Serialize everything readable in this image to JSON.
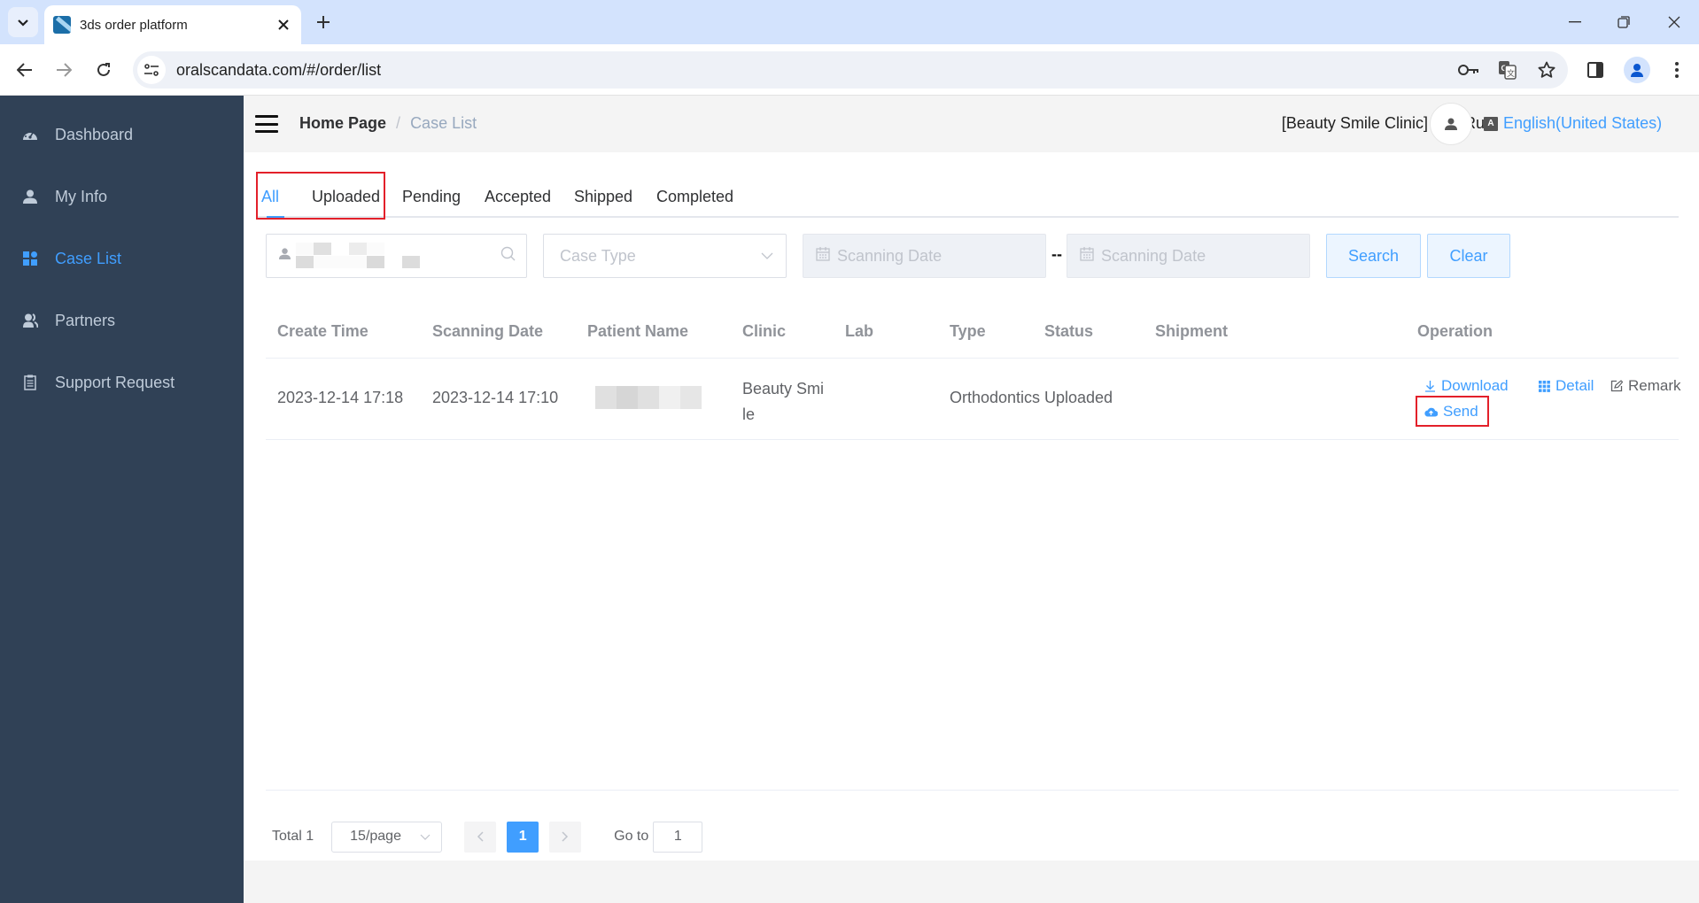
{
  "browser": {
    "tab_title": "3ds order platform",
    "url": "oralscandata.com/#/order/list",
    "icons": {
      "tab_search": "chevron-down-icon",
      "new_tab": "plus-icon",
      "back": "arrow-left-icon",
      "forward": "arrow-right-icon",
      "reload": "reload-icon",
      "password": "key-icon",
      "translate": "translate-icon",
      "bookmark": "star-icon",
      "side_panel": "side-panel-icon",
      "profile": "profile-icon",
      "menu": "kebab-menu-icon"
    },
    "glyphs": {
      "chevron": "⌄",
      "plus": "+",
      "close": "✕",
      "minimize": "—",
      "restore": "❐",
      "win_close": "✕",
      "back": "←",
      "forward": "→",
      "reload": "↻",
      "site_info": "⚙",
      "key": "⚿",
      "translate": "G文",
      "star": "☆",
      "side_panel": "▮",
      "menu": "⋮"
    }
  },
  "sidebar": {
    "items": [
      {
        "label": "Dashboard",
        "icon": "dashboard-gauge-icon",
        "active": false
      },
      {
        "label": "My Info",
        "icon": "user-icon",
        "active": false
      },
      {
        "label": "Case List",
        "icon": "grid-icon",
        "active": true
      },
      {
        "label": "Partners",
        "icon": "users-icon",
        "active": false
      },
      {
        "label": "Support Request",
        "icon": "clipboard-icon",
        "active": false
      }
    ]
  },
  "header": {
    "breadcrumb": {
      "home": "Home Page",
      "separator": "/",
      "current": "Case List"
    },
    "user_name": "[Beauty Smile Clinic] XiaoRu",
    "language": "English(United States)",
    "language_icon_text": "A"
  },
  "tabs": {
    "items": [
      {
        "label": "All",
        "active": true
      },
      {
        "label": "Uploaded",
        "active": false
      },
      {
        "label": "Pending",
        "active": false
      },
      {
        "label": "Accepted",
        "active": false
      },
      {
        "label": "Shipped",
        "active": false
      },
      {
        "label": "Completed",
        "active": false
      }
    ]
  },
  "filters": {
    "patient_search": {
      "value": "[redacted]",
      "icon": "search-icon"
    },
    "case_type": {
      "placeholder": "Case Type"
    },
    "date_start": {
      "placeholder": "Scanning Date"
    },
    "date_separator": "--",
    "date_end": {
      "placeholder": "Scanning Date"
    },
    "search_label": "Search",
    "clear_label": "Clear"
  },
  "table": {
    "columns": [
      "Create Time",
      "Scanning Date",
      "Patient Name",
      "Clinic",
      "Lab",
      "Type",
      "Status",
      "Shipment",
      "Operation"
    ],
    "rows": [
      {
        "create_time": "2023-12-14 17:18",
        "scanning_date": "2023-12-14 17:10",
        "patient_name": "[redacted]",
        "clinic_line1": "Beauty Smi",
        "clinic_line2": "le",
        "lab": "",
        "type": "Orthodontics",
        "status": "Uploaded",
        "shipment": "",
        "operations": {
          "download": "Download",
          "detail": "Detail",
          "remark": "Remark",
          "send": "Send"
        }
      }
    ]
  },
  "pagination": {
    "total_label": "Total 1",
    "page_size": "15/page",
    "current_page": "1",
    "goto_label": "Go to",
    "goto_value": "1"
  },
  "colors": {
    "accent": "#409eff",
    "sidebar_bg": "#304156",
    "highlight_box": "#e3202a"
  }
}
